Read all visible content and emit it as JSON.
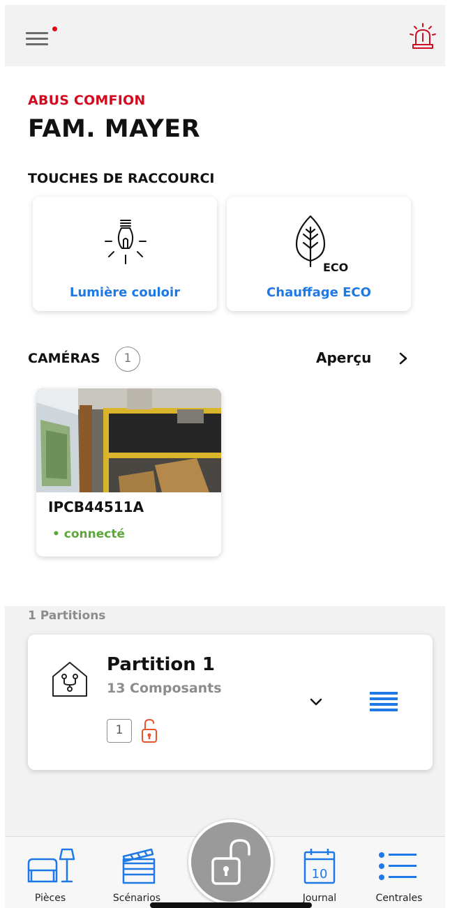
{
  "header": {
    "menu_icon": "hamburger-menu-icon",
    "notification_dot_color": "#e30613",
    "alarm_icon": "siren-icon"
  },
  "home": {
    "brand": "ABUS COMFION",
    "family": "FAM. MAYER"
  },
  "shortcuts": {
    "title": "TOUCHES DE RACCOURCI",
    "items": [
      {
        "label": "Lumière couloir",
        "icon": "light-bulb-icon"
      },
      {
        "label": "Chauffage ECO",
        "icon": "eco-leaf-icon",
        "icon_text": "ECO"
      }
    ]
  },
  "cameras": {
    "title": "CAMÉRAS",
    "count": "1",
    "overview_label": "Aperçu",
    "items": [
      {
        "name": "IPCB44511A",
        "status": "• connecté",
        "status_color": "#5aa838"
      }
    ]
  },
  "partitions": {
    "header": "1 Partitions",
    "items": [
      {
        "name": "Partition 1",
        "subtitle": "13 Composants",
        "badge": "1",
        "lock_state": "unlocked",
        "lock_color": "#e8552a"
      }
    ]
  },
  "tabbar": {
    "tabs": [
      {
        "label": "Pièces",
        "icon": "armchair-lamp-icon"
      },
      {
        "label": "Scénarios",
        "icon": "clapperboard-icon"
      },
      {
        "label": "Journal",
        "icon": "calendar-icon",
        "icon_text": "10"
      },
      {
        "label": "Centrales",
        "icon": "list-icon"
      }
    ],
    "center_button_icon": "unlocked-padlock-icon"
  },
  "colors": {
    "accent_red": "#d10a1f",
    "accent_blue": "#1e78e6",
    "status_green": "#5aa838"
  }
}
